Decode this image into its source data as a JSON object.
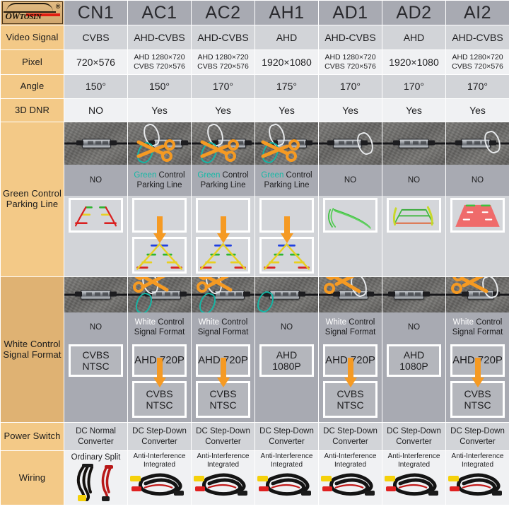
{
  "brand": {
    "name_ow": "OW",
    "name_tosin": "TOSIN",
    "registered": "®"
  },
  "columns": [
    "CN1",
    "AC1",
    "AC2",
    "AH1",
    "AD1",
    "AD2",
    "AI2"
  ],
  "rows": {
    "video_signal": {
      "label": "Video Signal",
      "values": [
        "CVBS",
        "AHD-CVBS",
        "AHD-CVBS",
        "AHD",
        "AHD-CVBS",
        "AHD",
        "AHD-CVBS"
      ]
    },
    "pixel": {
      "label": "Pixel",
      "values": [
        [
          "720×576"
        ],
        [
          "AHD 1280×720",
          "CVBS 720×576"
        ],
        [
          "AHD 1280×720",
          "CVBS 720×576"
        ],
        [
          "1920×1080"
        ],
        [
          "AHD 1280×720",
          "CVBS 720×576"
        ],
        [
          "1920×1080"
        ],
        [
          "AHD 1280×720",
          "CVBS 720×576"
        ]
      ]
    },
    "angle": {
      "label": "Angle",
      "values": [
        "150°",
        "150°",
        "170°",
        "175°",
        "170°",
        "170°",
        "170°"
      ]
    },
    "dnr": {
      "label": "3D DNR",
      "values": [
        "NO",
        "Yes",
        "Yes",
        "Yes",
        "Yes",
        "Yes",
        "Yes"
      ]
    },
    "green_control": {
      "label": "Green Control Parking Line",
      "caption_word1": "Green",
      "caption_rest": " Control",
      "caption_line2": "Parking Line",
      "cells": [
        {
          "has_scissors": false,
          "caption": "NO",
          "preview_top": "static-lines",
          "preview_bottom": "none",
          "arrow": false
        },
        {
          "has_scissors": true,
          "caption": "GREEN",
          "preview_top": "empty",
          "preview_bottom": "dynamic-lines",
          "arrow": true
        },
        {
          "has_scissors": true,
          "caption": "GREEN",
          "preview_top": "empty",
          "preview_bottom": "dynamic-lines",
          "arrow": true
        },
        {
          "has_scissors": true,
          "caption": "GREEN",
          "preview_top": "empty",
          "preview_bottom": "dynamic-lines",
          "arrow": true
        },
        {
          "has_scissors": false,
          "caption": "NO",
          "preview_top": "green-curve",
          "preview_bottom": "none",
          "arrow": false
        },
        {
          "has_scissors": false,
          "caption": "NO",
          "preview_top": "green-trap",
          "preview_bottom": "none",
          "arrow": false
        },
        {
          "has_scissors": false,
          "caption": "NO",
          "preview_top": "red-carpet",
          "preview_bottom": "none",
          "arrow": false
        }
      ]
    },
    "white_control": {
      "label": "White Control Signal Format",
      "caption_word1": "White",
      "caption_rest": " Control",
      "caption_line2": "Signal Format",
      "cells": [
        {
          "has_scissors": false,
          "caption": "NO",
          "box_top": [
            "CVBS",
            "NTSC"
          ],
          "box_bottom": [],
          "arrow": false
        },
        {
          "has_scissors": true,
          "caption": "WHITE",
          "box_top": [
            "AHD 720P"
          ],
          "box_bottom": [
            "CVBS",
            "NTSC"
          ],
          "arrow": true
        },
        {
          "has_scissors": true,
          "caption": "WHITE",
          "box_top": [
            "AHD 720P"
          ],
          "box_bottom": [
            "CVBS",
            "NTSC"
          ],
          "arrow": true
        },
        {
          "has_scissors": false,
          "caption": "NO",
          "box_top": [
            "AHD",
            "1080P"
          ],
          "box_bottom": [],
          "arrow": false
        },
        {
          "has_scissors": true,
          "caption": "WHITE",
          "box_top": [
            "AHD 720P"
          ],
          "box_bottom": [
            "CVBS",
            "NTSC"
          ],
          "arrow": true
        },
        {
          "has_scissors": false,
          "caption": "NO",
          "box_top": [
            "AHD",
            "1080P"
          ],
          "box_bottom": [],
          "arrow": false
        },
        {
          "has_scissors": true,
          "caption": "WHITE",
          "box_top": [
            "AHD 720P"
          ],
          "box_bottom": [
            "CVBS",
            "NTSC"
          ],
          "arrow": true
        }
      ]
    },
    "power_switch": {
      "label": "Power Switch",
      "values": [
        [
          "DC Normal",
          "Converter"
        ],
        [
          "DC Step-Down",
          "Converter"
        ],
        [
          "DC Step-Down",
          "Converter"
        ],
        [
          "DC Step-Down",
          "Converter"
        ],
        [
          "DC Step-Down",
          "Converter"
        ],
        [
          "DC Step-Down",
          "Converter"
        ],
        [
          "DC Step-Down",
          "Converter"
        ]
      ]
    },
    "wiring": {
      "label": "Wiring",
      "values": [
        [
          "Ordinary Split"
        ],
        [
          "Anti-Interference",
          "Integrated"
        ],
        [
          "Anti-Interference",
          "Integrated"
        ],
        [
          "Anti-Interference",
          "Integrated"
        ],
        [
          "Anti-Interference",
          "Integrated"
        ],
        [
          "Anti-Interference",
          "Integrated"
        ],
        [
          "Anti-Interference",
          "Integrated"
        ]
      ],
      "types": [
        "split",
        "integrated",
        "integrated",
        "integrated",
        "integrated",
        "integrated",
        "integrated"
      ]
    }
  },
  "colors": {
    "label_bg": "#f3c987",
    "label_bg_dark": "#dfb273",
    "header_bg": "#a8aab2",
    "row_alt_a": "#d2d4d8",
    "row_alt_b": "#f0f1f3",
    "accent_orange": "#f59a23",
    "accent_green": "#14b8a6",
    "logo_red": "#e01d12"
  }
}
